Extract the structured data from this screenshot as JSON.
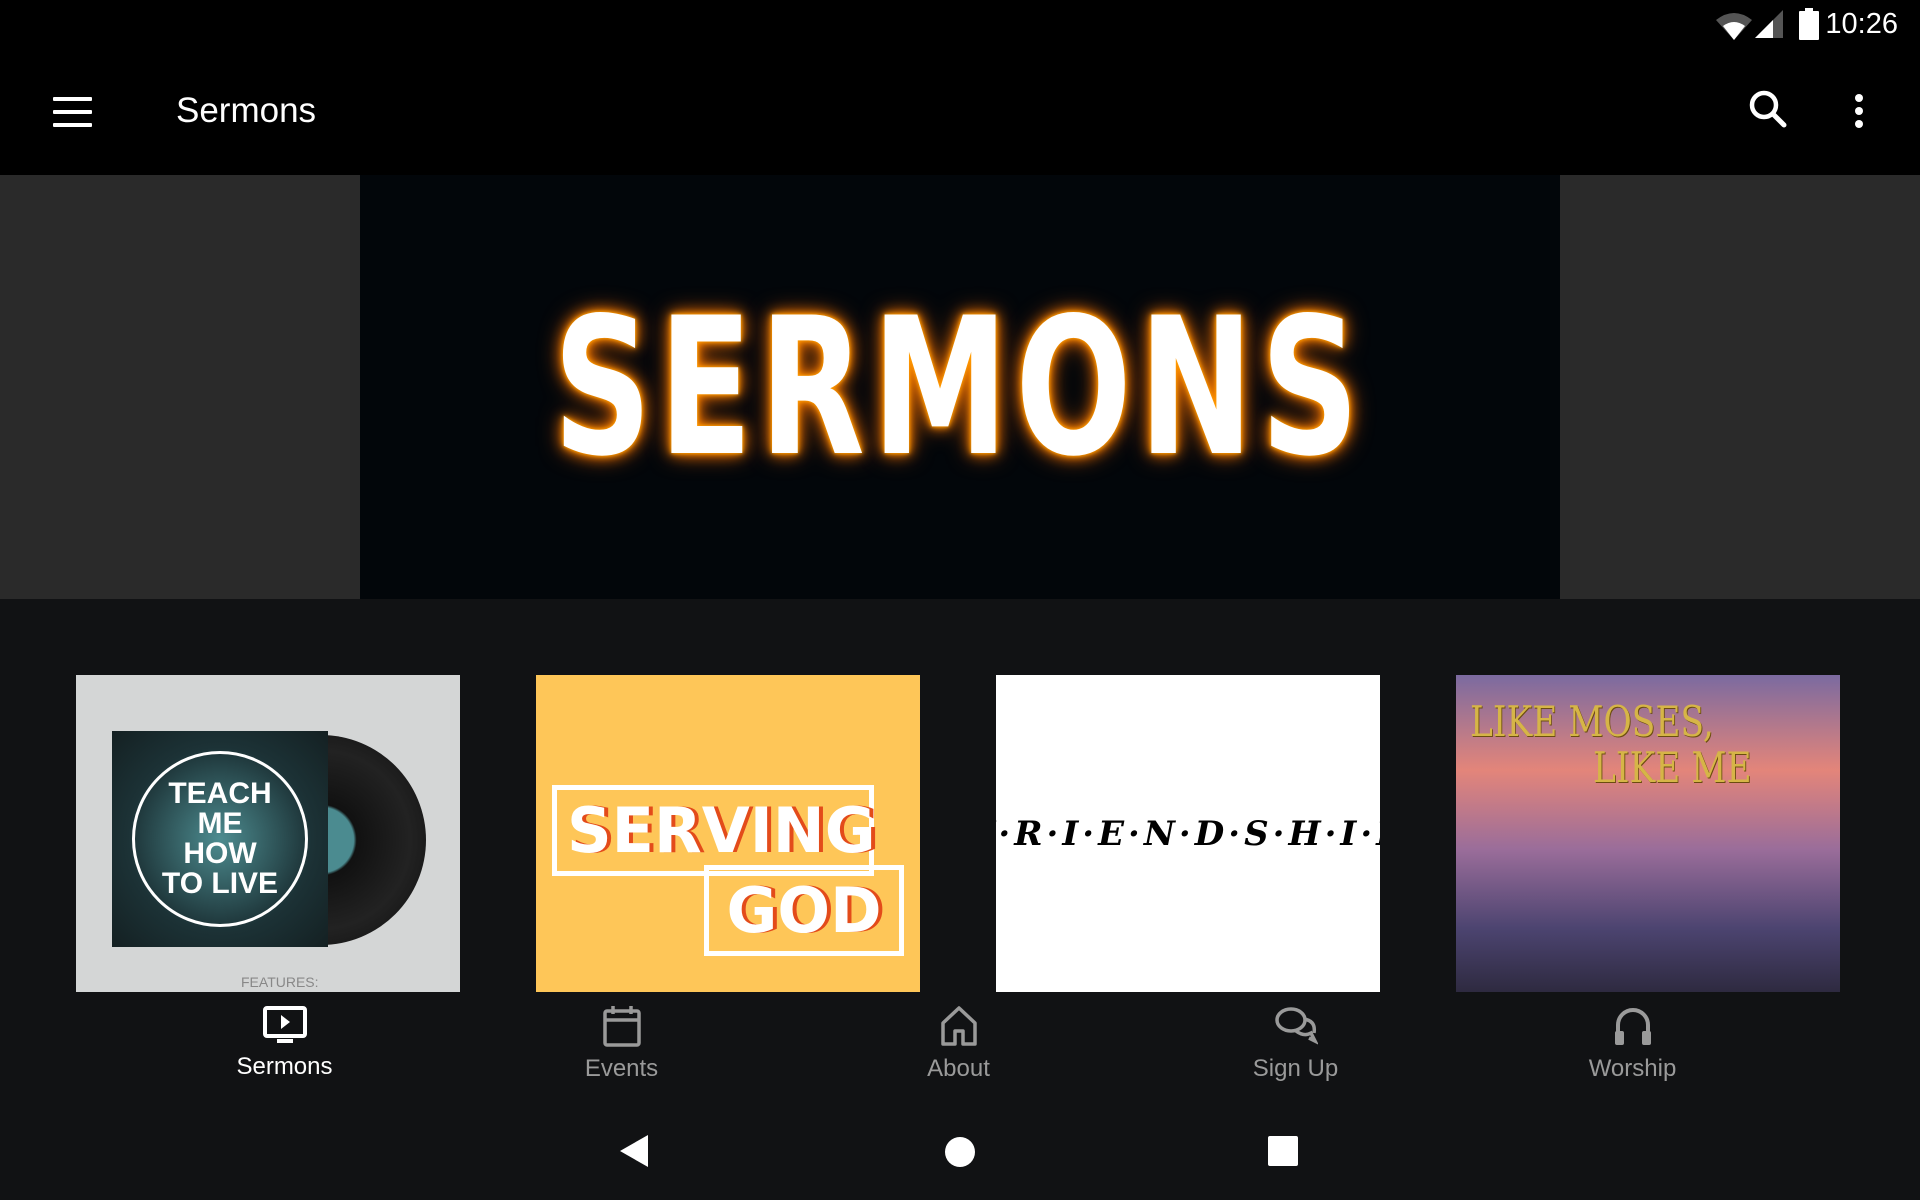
{
  "status_bar": {
    "time": "10:26",
    "icons": [
      "wifi-icon",
      "cell-signal-icon",
      "battery-icon"
    ]
  },
  "toolbar": {
    "title": "Sermons",
    "icons": [
      "menu-icon",
      "search-icon",
      "more-vert-icon"
    ]
  },
  "banner": {
    "text": "SERMONS",
    "glow_color": "#ff9d00"
  },
  "cards": [
    {
      "title_lines": [
        "TEACH",
        "ME",
        "HOW",
        "TO LIVE"
      ],
      "footer": "FEATURES:"
    },
    {
      "line1": "SERVING",
      "line2": "GOD"
    },
    {
      "title": "F·R·I·E·N·D·S·H·I·P"
    },
    {
      "line1": "LIKE MOSES,",
      "line2": "LIKE ME"
    }
  ],
  "bottom_nav": [
    {
      "label": "Sermons",
      "icon": "tv-play-icon",
      "active": true
    },
    {
      "label": "Events",
      "icon": "calendar-icon"
    },
    {
      "label": "About",
      "icon": "home-icon"
    },
    {
      "label": "Sign Up",
      "icon": "chat-bubbles-icon"
    },
    {
      "label": "Worship",
      "icon": "headphones-icon"
    }
  ],
  "system_nav": [
    "back-icon",
    "home-circle-icon",
    "recents-icon"
  ]
}
